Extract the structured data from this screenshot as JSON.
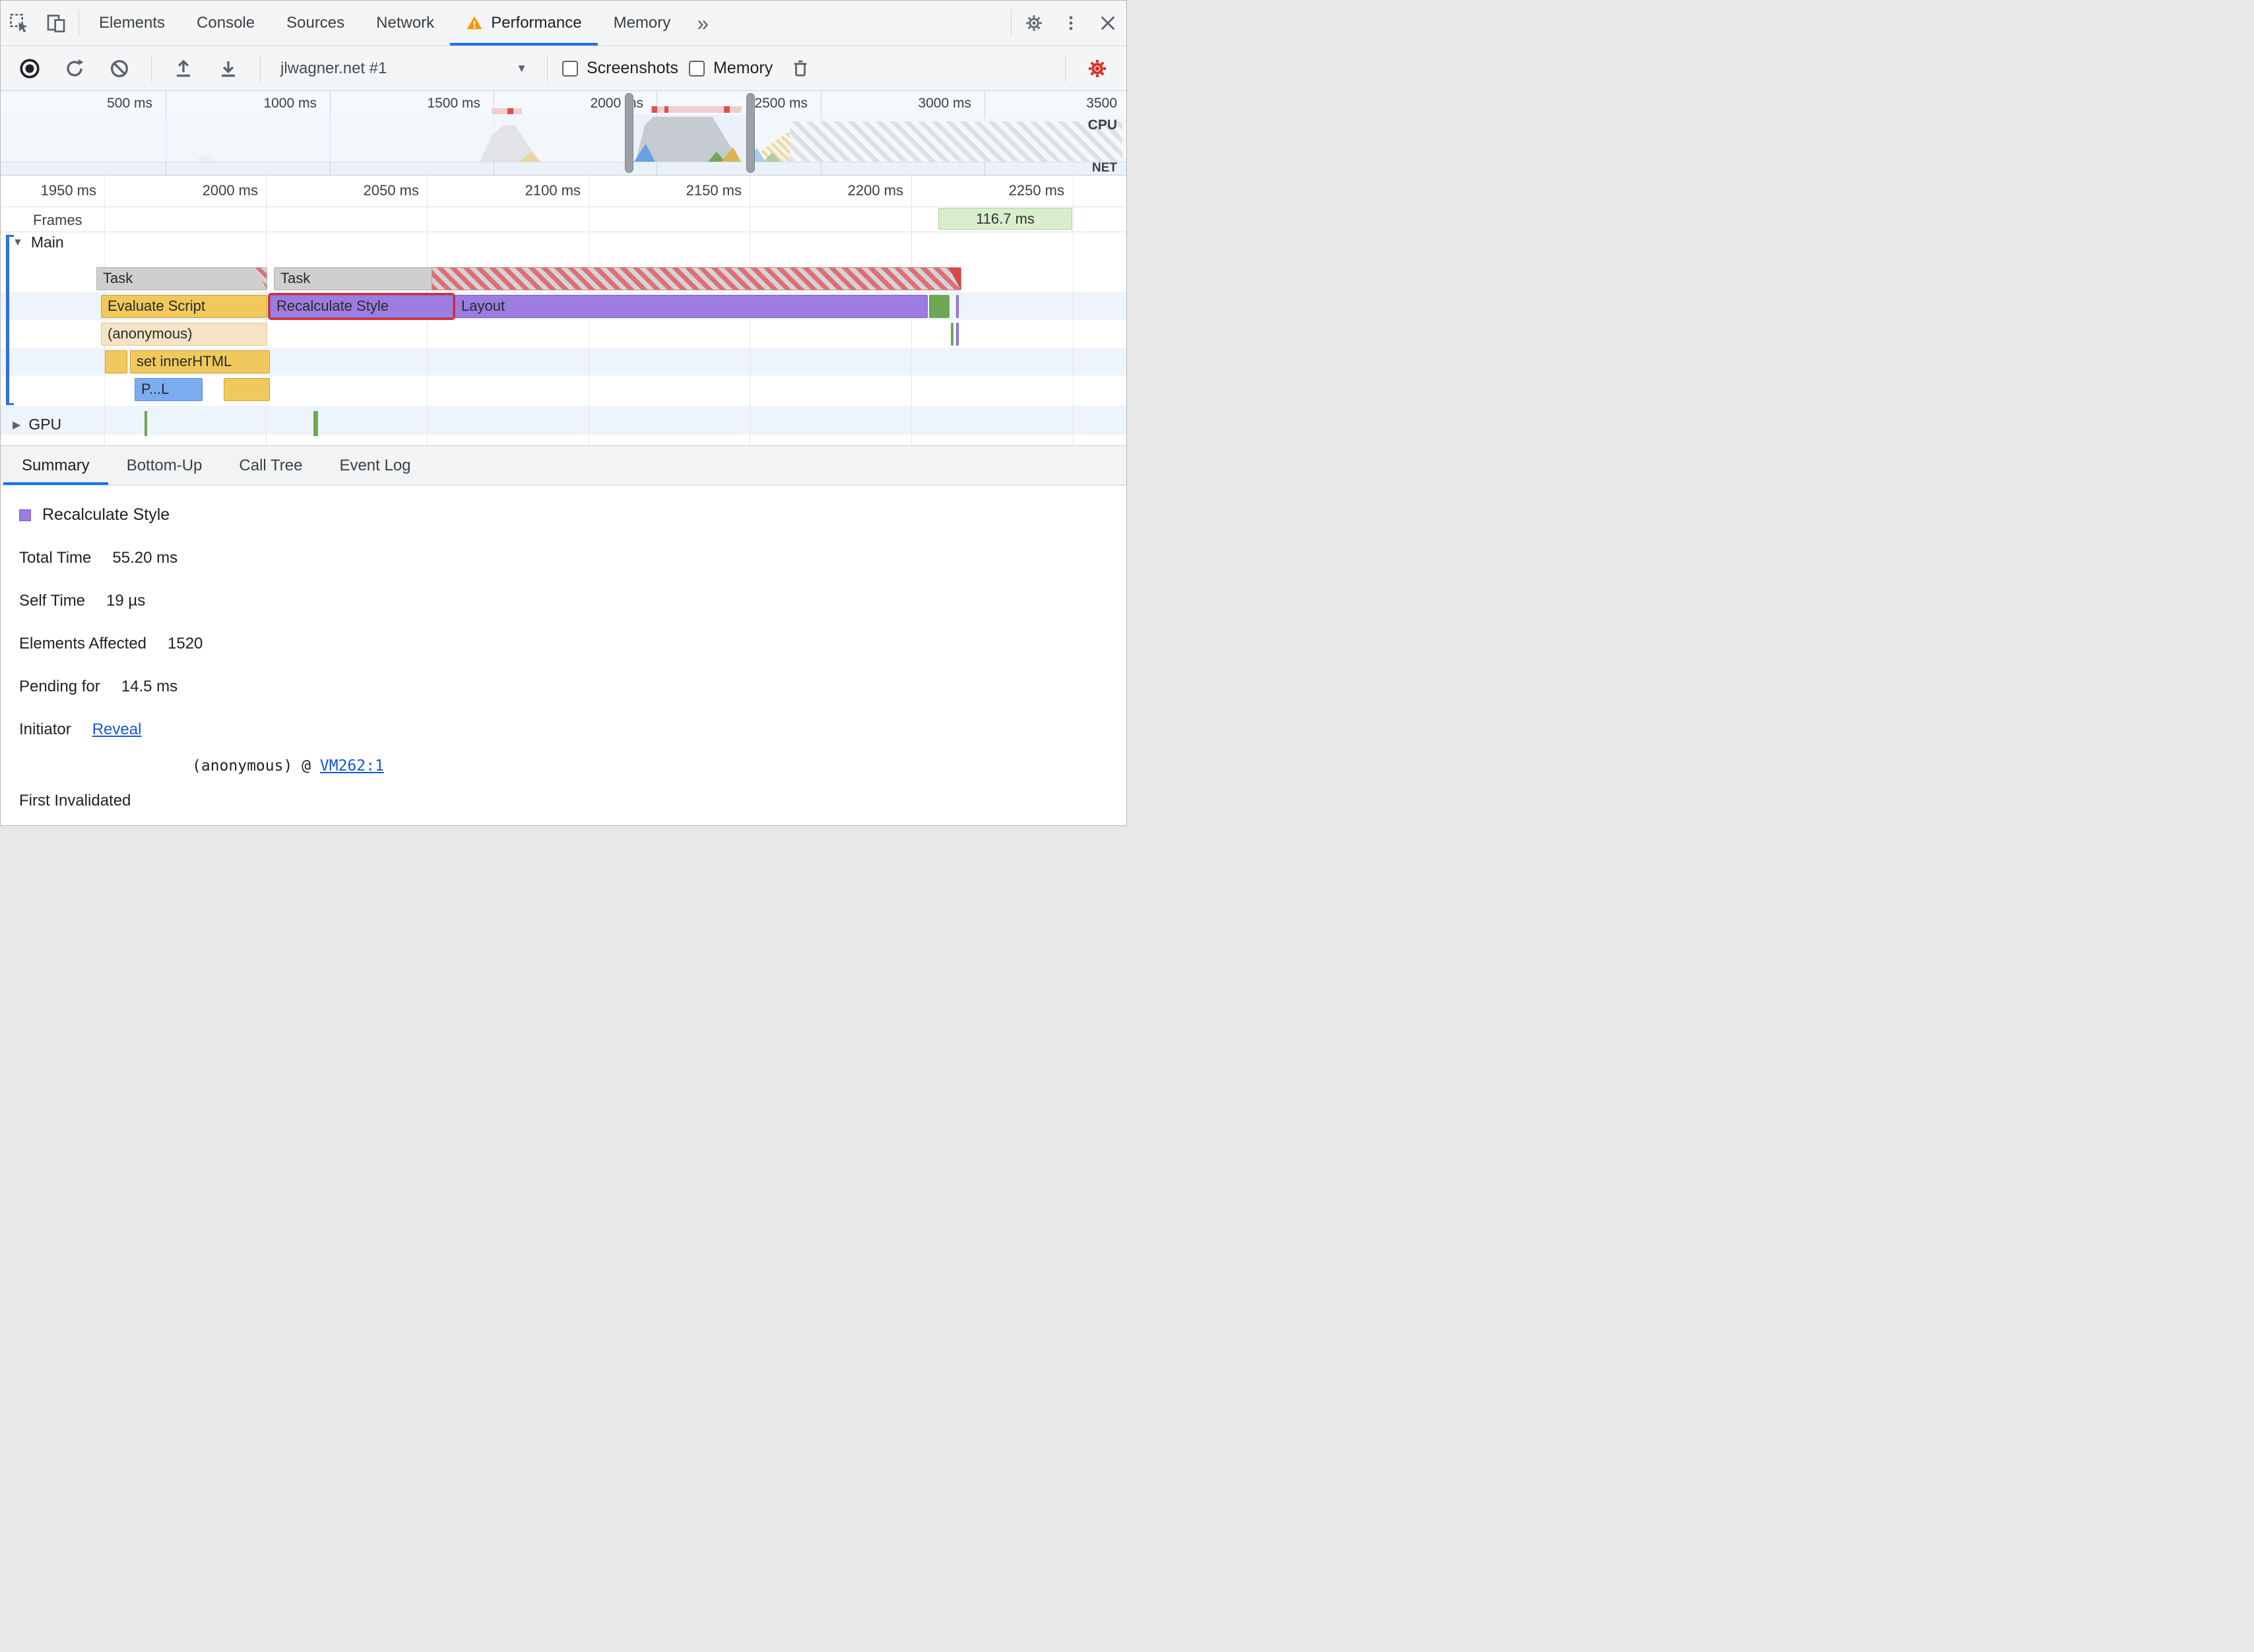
{
  "tabs": {
    "items": [
      {
        "label": "Elements"
      },
      {
        "label": "Console"
      },
      {
        "label": "Sources"
      },
      {
        "label": "Network"
      },
      {
        "label": "Performance"
      },
      {
        "label": "Memory"
      }
    ],
    "more": "»"
  },
  "toolbar": {
    "profile_select": "jlwagner.net #1",
    "screenshots_label": "Screenshots",
    "memory_label": "Memory"
  },
  "overview": {
    "ticks": [
      "500 ms",
      "1000 ms",
      "1500 ms",
      "2000 ms",
      "2500 ms",
      "3000 ms",
      "3500"
    ],
    "cpu_label": "CPU",
    "net_label": "NET"
  },
  "detail": {
    "ticks": [
      "1950 ms",
      "2000 ms",
      "2050 ms",
      "2100 ms",
      "2150 ms",
      "2200 ms",
      "2250 ms"
    ],
    "frames_label": "Frames",
    "frame_duration": "116.7 ms",
    "main_label": "Main",
    "gpu_label": "GPU",
    "bars": {
      "task1": "Task",
      "task2": "Task",
      "evaluate_script": "Evaluate Script",
      "recalculate_style": "Recalculate Style",
      "layout": "Layout",
      "anonymous": "(anonymous)",
      "set_inner_html": "set innerHTML",
      "paint_truncated": "P...L"
    }
  },
  "bottom_tabs": {
    "items": [
      {
        "label": "Summary"
      },
      {
        "label": "Bottom-Up"
      },
      {
        "label": "Call Tree"
      },
      {
        "label": "Event Log"
      }
    ]
  },
  "summary": {
    "title": "Recalculate Style",
    "rows": [
      {
        "label": "Total Time",
        "value": "55.20 ms"
      },
      {
        "label": "Self Time",
        "value": "19 µs"
      },
      {
        "label": "Elements Affected",
        "value": "1520"
      },
      {
        "label": "Pending for",
        "value": "14.5 ms"
      }
    ],
    "initiator_label": "Initiator",
    "initiator_link": "Reveal",
    "first_invalidated_label": "First Invalidated",
    "first_invalidated_code": "(anonymous) @ ",
    "first_invalidated_link": "VM262:1"
  },
  "colors": {
    "accent": "#1a73e8",
    "warning": "#f29900",
    "record": "#202124",
    "perf_settings_red": "#d93025",
    "scripting_yellow": "#f0c95c",
    "rendering_purple": "#9c7ce0",
    "painting_green": "#6fa854",
    "task_gray": "#cfcfcf",
    "long_task_red": "#df6e76",
    "link_blue": "#1558d6",
    "frame_green": "#d8eecd"
  }
}
